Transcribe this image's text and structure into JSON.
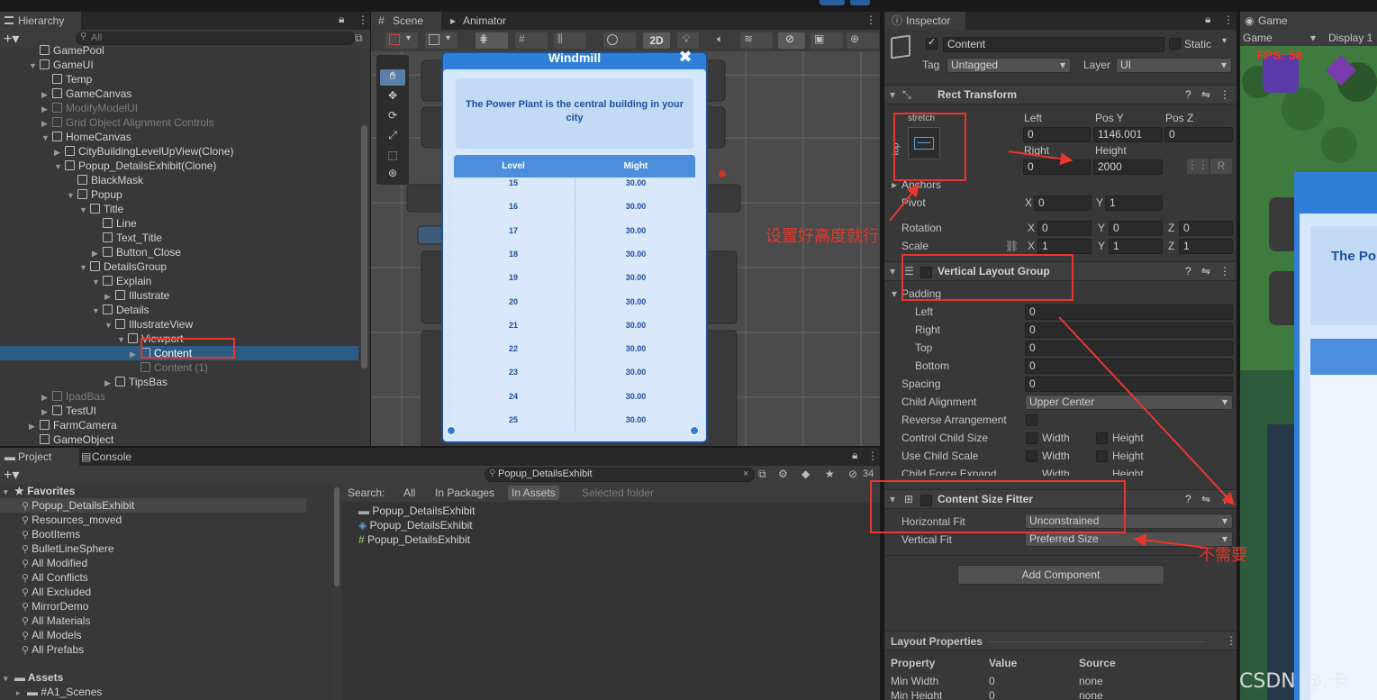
{
  "tabs": {
    "hierarchy": "Hierarchy",
    "scene": "Scene",
    "animator": "Animator",
    "inspector": "Inspector",
    "game": "Game",
    "project": "Project",
    "console": "Console"
  },
  "hierarchy": {
    "search_placeholder": "All",
    "items": [
      {
        "label": "GamePool",
        "indent": 3,
        "dim": false
      },
      {
        "label": "GameUI",
        "indent": 3,
        "arrow": "open"
      },
      {
        "label": "Temp",
        "indent": 4
      },
      {
        "label": "GameCanvas",
        "indent": 4,
        "arrow": "closed"
      },
      {
        "label": "ModifyModelUI",
        "indent": 4,
        "arrow": "closed",
        "dim": true
      },
      {
        "label": "Grid Object Alignment Controls",
        "indent": 4,
        "arrow": "closed",
        "dim": true
      },
      {
        "label": "HomeCanvas",
        "indent": 4,
        "arrow": "open"
      },
      {
        "label": "CityBuildingLevelUpView(Clone)",
        "indent": 5,
        "arrow": "closed"
      },
      {
        "label": "Popup_DetailsExhibit(Clone)",
        "indent": 5,
        "arrow": "open"
      },
      {
        "label": "BlackMask",
        "indent": 6
      },
      {
        "label": "Popup",
        "indent": 6,
        "arrow": "open"
      },
      {
        "label": "Title",
        "indent": 7,
        "arrow": "open"
      },
      {
        "label": "Line",
        "indent": 8
      },
      {
        "label": "Text_Title",
        "indent": 8
      },
      {
        "label": "Button_Close",
        "indent": 8,
        "arrow": "closed"
      },
      {
        "label": "DetailsGroup",
        "indent": 7,
        "arrow": "open"
      },
      {
        "label": "Explain",
        "indent": 8,
        "arrow": "open"
      },
      {
        "label": "Illustrate",
        "indent": 9,
        "arrow": "closed"
      },
      {
        "label": "Details",
        "indent": 8,
        "arrow": "open"
      },
      {
        "label": "IllustrateView",
        "indent": 9,
        "arrow": "open"
      },
      {
        "label": "Viewport",
        "indent": 10,
        "arrow": "open"
      },
      {
        "label": "Content",
        "indent": 11,
        "arrow": "closed",
        "selected": true
      },
      {
        "label": "Content (1)",
        "indent": 11,
        "dim": true
      },
      {
        "label": "TipsBas",
        "indent": 9,
        "arrow": "closed"
      },
      {
        "label": "IpadBas",
        "indent": 4,
        "arrow": "closed",
        "dim": true
      },
      {
        "label": "TestUI",
        "indent": 4,
        "arrow": "closed"
      },
      {
        "label": "FarmCamera",
        "indent": 3,
        "arrow": "closed"
      },
      {
        "label": "GameObject",
        "indent": 3
      }
    ]
  },
  "scene": {
    "mode_2d": "2D",
    "popup_title": "Windmill",
    "popup_desc": "The Power Plant is the central building in your city",
    "col_level": "Level",
    "col_might": "Might",
    "rows": [
      [
        "15",
        "30.00"
      ],
      [
        "16",
        "30.00"
      ],
      [
        "17",
        "30.00"
      ],
      [
        "18",
        "30.00"
      ],
      [
        "19",
        "30.00"
      ],
      [
        "20",
        "30.00"
      ],
      [
        "21",
        "30.00"
      ],
      [
        "22",
        "30.00"
      ],
      [
        "23",
        "30.00"
      ],
      [
        "24",
        "30.00"
      ],
      [
        "25",
        "30.00"
      ]
    ]
  },
  "inspector": {
    "object_name": "Content",
    "static_label": "Static",
    "tag_label": "Tag",
    "tag_value": "Untagged",
    "layer_label": "Layer",
    "layer_value": "UI",
    "rect": {
      "title": "Rect Transform",
      "stretch": "stretch",
      "top": "top",
      "left_label": "Left",
      "left": "0",
      "posy_label": "Pos Y",
      "posy": "1146.001",
      "posz_label": "Pos Z",
      "posz": "0",
      "right_label": "Right",
      "right": "0",
      "height_label": "Height",
      "height": "2000",
      "anchors": "Anchors",
      "pivot": "Pivot",
      "pivot_x": "0",
      "pivot_y": "1",
      "rotation": "Rotation",
      "rot_x": "0",
      "rot_y": "0",
      "rot_z": "0",
      "scale": "Scale",
      "sc_x": "1",
      "sc_y": "1",
      "sc_z": "1",
      "r_btn": "R"
    },
    "vlg": {
      "title": "Vertical Layout Group",
      "padding": "Padding",
      "left": "Left",
      "right": "Right",
      "top": "Top",
      "bottom": "Bottom",
      "left_v": "0",
      "right_v": "0",
      "top_v": "0",
      "bottom_v": "0",
      "spacing": "Spacing",
      "spacing_v": "0",
      "child_alignment": "Child Alignment",
      "child_alignment_v": "Upper Center",
      "reverse": "Reverse Arrangement",
      "control_child": "Control Child Size",
      "use_scale": "Use Child Scale",
      "force_expand": "Child Force Expand",
      "width": "Width",
      "height": "Height"
    },
    "csf": {
      "title": "Content Size Fitter",
      "hfit": "Horizontal Fit",
      "hfit_v": "Unconstrained",
      "vfit": "Vertical Fit",
      "vfit_v": "Preferred Size"
    },
    "add_component": "Add Component",
    "layout_props": {
      "title": "Layout Properties",
      "property": "Property",
      "value": "Value",
      "source": "Source",
      "rows": [
        [
          "Min Width",
          "0",
          "none"
        ],
        [
          "Min Height",
          "0",
          "none"
        ]
      ]
    }
  },
  "game": {
    "display_label": "Game",
    "display": "Display 1",
    "fps": "FPS: 58",
    "card_text": "The Po"
  },
  "project": {
    "search_value": "Popup_DetailsExhibit",
    "count": "34",
    "favorites_label": "Favorites",
    "favorites": [
      "Popup_DetailsExhibit",
      "Resources_moved",
      "BootItems",
      "BulletLineSphere",
      "All Modified",
      "All Conflicts",
      "All Excluded",
      "MirrorDemo",
      "All Materials",
      "All Models",
      "All Prefabs"
    ],
    "assets_label": "Assets",
    "assets_child": "#A1_Scenes",
    "search_label": "Search:",
    "filters": [
      "All",
      "In Packages",
      "In Assets",
      "Selected folder"
    ],
    "results": [
      {
        "icon": "folder-icon",
        "label": "Popup_DetailsExhibit"
      },
      {
        "icon": "prefab-icon",
        "label": "Popup_DetailsExhibit"
      },
      {
        "icon": "script-icon",
        "label": "Popup_DetailsExhibit"
      }
    ]
  },
  "annotations": {
    "note_height": "设置好高度就行",
    "note_not_needed": "不需要",
    "watermark": "CSDN @.卡"
  },
  "colors": {
    "accent_red": "#e8372c",
    "selection": "#2c5d87",
    "popup_blue": "#2f7fd8"
  }
}
